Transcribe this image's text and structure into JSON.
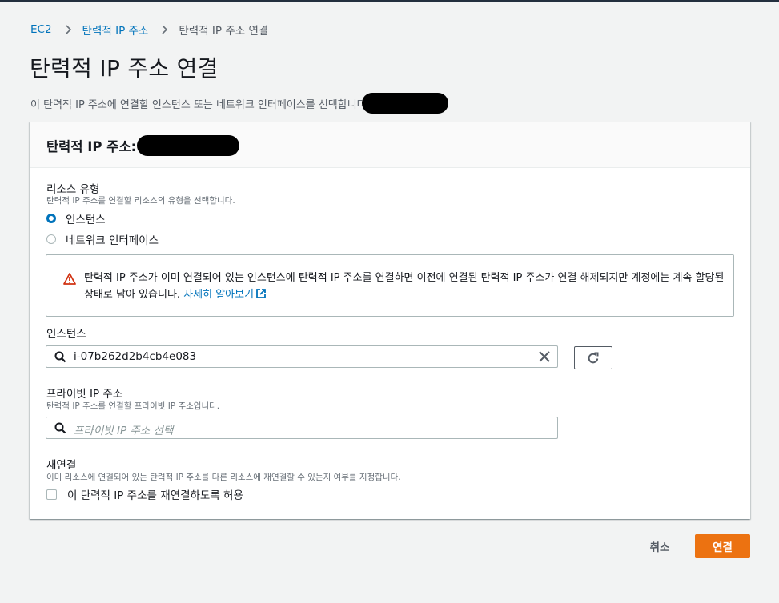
{
  "breadcrumb": {
    "items": [
      {
        "label": "EC2"
      },
      {
        "label": "탄력적 IP 주소"
      },
      {
        "label": "탄력적 IP 주소 연결"
      }
    ]
  },
  "page": {
    "title": "탄력적 IP 주소 연결",
    "description": "이 탄력적 IP 주소에 연결할 인스턴스 또는 네트워크 인터페이스를 선택합니다"
  },
  "panel": {
    "title": "탄력적 IP 주소:"
  },
  "resource_type": {
    "label": "리소스 유형",
    "hint": "탄력적 IP 주소를 연결할 리소스의 유형을 선택합니다.",
    "options": [
      {
        "label": "인스턴스",
        "selected": true
      },
      {
        "label": "네트워크 인터페이스",
        "selected": false
      }
    ]
  },
  "alert": {
    "icon": "warning-icon",
    "text": "탄력적 IP 주소가 이미 연결되어 있는 인스턴스에 탄력적 IP 주소를 연결하면 이전에 연결된 탄력적 IP 주소가 연결 해제되지만 계정에는 계속 할당된 상태로 남아 있습니다.",
    "link": "자세히 알아보기",
    "color": "#d13212"
  },
  "instance": {
    "label": "인스턴스",
    "value": "i-07b262d2b4cb4e083"
  },
  "private_ip": {
    "label": "프라이빗 IP 주소",
    "hint": "탄력적 IP 주소를 연결할 프라이빗 IP 주소입니다.",
    "placeholder": "프라이빗 IP 주소 선택"
  },
  "reassociation": {
    "label": "재연결",
    "hint": "이미 리소스에 연결되어 있는 탄력적 IP 주소를 다른 리소스에 재연결할 수 있는지 여부를 지정합니다.",
    "checkbox_label": "이 탄력적 IP 주소를 재연결하도록 허용",
    "checked": false
  },
  "actions": {
    "cancel": "취소",
    "submit": "연결"
  },
  "colors": {
    "link": "#0073bb",
    "primary": "#ec7211",
    "header_bar": "#232f3e"
  }
}
